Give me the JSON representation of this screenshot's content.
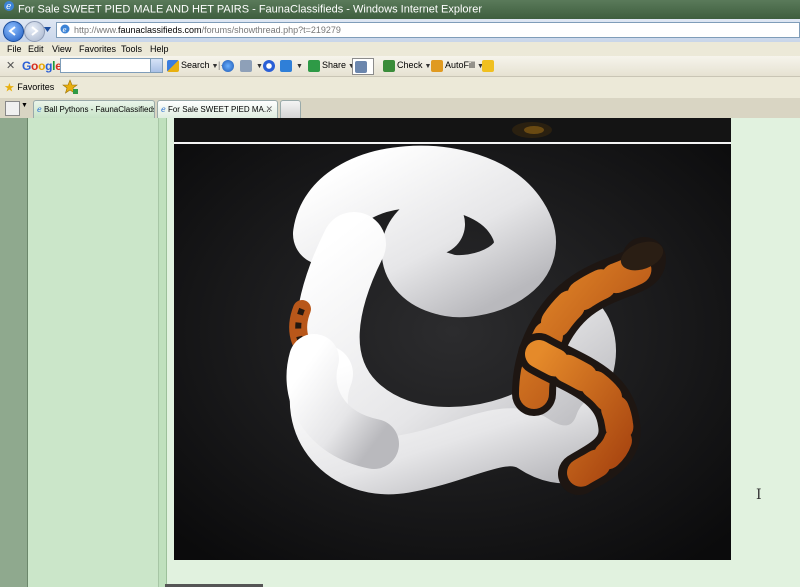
{
  "window": {
    "title": "For Sale SWEET PIED MALE AND HET PAIRS - FaunaClassifieds - Windows Internet Explorer"
  },
  "address": {
    "url_prefix": "http://www.",
    "url_host": "faunaclassifieds.com",
    "url_path": "/forums/showthread.php?t=219279"
  },
  "menu": {
    "items": [
      "File",
      "Edit",
      "View",
      "Favorites",
      "Tools",
      "Help"
    ]
  },
  "google_toolbar": {
    "logo": "Google",
    "search_label": "Search",
    "share_label": "Share",
    "check_label": "Check",
    "autofill_label": "AutoFill"
  },
  "favorites": {
    "label": "Favorites"
  },
  "tabs": [
    {
      "label": "Ball Pythons - FaunaClassifieds"
    },
    {
      "label": "For Sale SWEET PIED MA..."
    }
  ],
  "colors": {
    "page_bg": "#d6ecd4",
    "snake_white": "#f2f2f2",
    "snake_orange": "#c8641a"
  },
  "icons": {
    "browser": "ie-icon",
    "back": "back-arrow-icon",
    "forward": "forward-arrow-icon",
    "star": "star-icon"
  }
}
